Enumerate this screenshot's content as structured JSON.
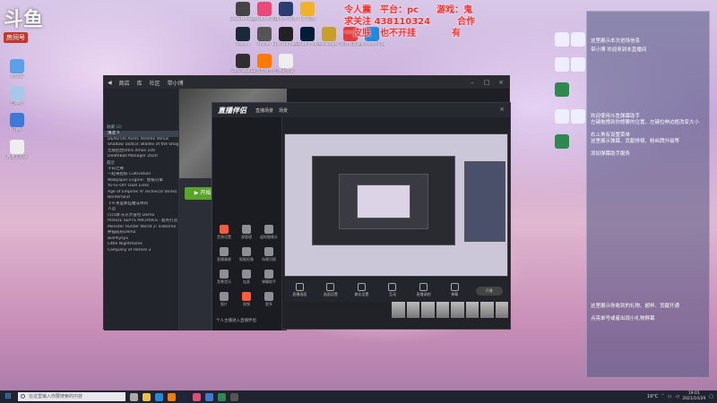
{
  "logo": {
    "big": "斗鱼",
    "sub": "房间号"
  },
  "overlay": {
    "line1": "令人震　平台：pc　　游戏：鬼",
    "line2": "求关注 438110324　　　合作",
    "line3": "一皮肤　也不开挂　　　　有"
  },
  "chat": {
    "header": "",
    "messages": [
      "这里展示本次进场信息",
      "带小博 欢迎来到本直播间",
      "欢迎使用斗鱼弹幕助手",
      "左键拖拽到你想要的位置，左键拉伸边框改变大小",
      "右上角有设置菜单",
      "这里展示弹幕、贡献排榜、粉丝牌升级等",
      "添加弹幕助手服务",
      "这里展示你收到的礼物、超样、贡献开通",
      "点亮单号或者出现小礼物屏幕"
    ]
  },
  "steam": {
    "tabs": [
      "商店",
      "库",
      "社区",
      "带小博"
    ],
    "section_recent": "最近",
    "section_favorites": "收藏 (2)",
    "games": [
      "鬼泣 5",
      "DEAD OR ALIVE Xtreme Venus",
      "Shadow Tactics: Blades of the Shogun",
      "无限回合Ultra Xmas 100",
      "Deathball Manager 2020",
      "十日之缘",
      "一起来捉妖 Cultivation",
      "Wallpaper Engine：壁纸引擎",
      "Yu-Gi-Oh! Duel Links",
      "Age of Empires IV Technical Stress",
      "Borderland",
      "下午茶里那些魔法师的",
      "人造",
      "凸凸球·东京大冒险 Demo",
      "ROGUE SEPTS ARCHIVES · 超英打造",
      "Monster Hunter World 2: Iceborne",
      "养猫成长Demo",
      "BioPhysyx",
      "Little Nightmares",
      "Company of Heroes 2"
    ],
    "play_label": "▶ 开始"
  },
  "stream": {
    "brand": "直播伴侣",
    "tabs": [
      "直播场景",
      "场景"
    ],
    "tools": [
      "音频设置",
      "源管理",
      "虚拟摄像头",
      "直播美颜",
      "智能抠像",
      "场景切换",
      "背景音乐",
      "连麦",
      "弹幕助手",
      "图片",
      "视频",
      "更多"
    ],
    "control_labels": [
      "直播画面",
      "画面设置",
      "美化设置",
      "互动",
      "直播录制",
      "弹幕",
      "开播"
    ],
    "bottom_link": "个人主播进入直播伴侣"
  },
  "taskbar": {
    "search_placeholder": "在这里输入你要搜索的内容",
    "weather": "19°C",
    "time": "19:01",
    "date": "2021/10/29"
  },
  "desktop_icons": [
    "GARENA 游戏",
    "WeGame 游戏",
    "UPLAY 游戏",
    "EA 游戏",
    "Steam",
    "Fiddler",
    "Epic Games Launcher",
    "Adobe Photoshop",
    "Wallpaper",
    "雷神加速器",
    "Microsoft Edge",
    "此电脑",
    "回收站",
    "TIM",
    "网易云音乐",
    "斗鱼直播伴侣",
    "OBS Studio",
    "腾讯会议"
  ]
}
